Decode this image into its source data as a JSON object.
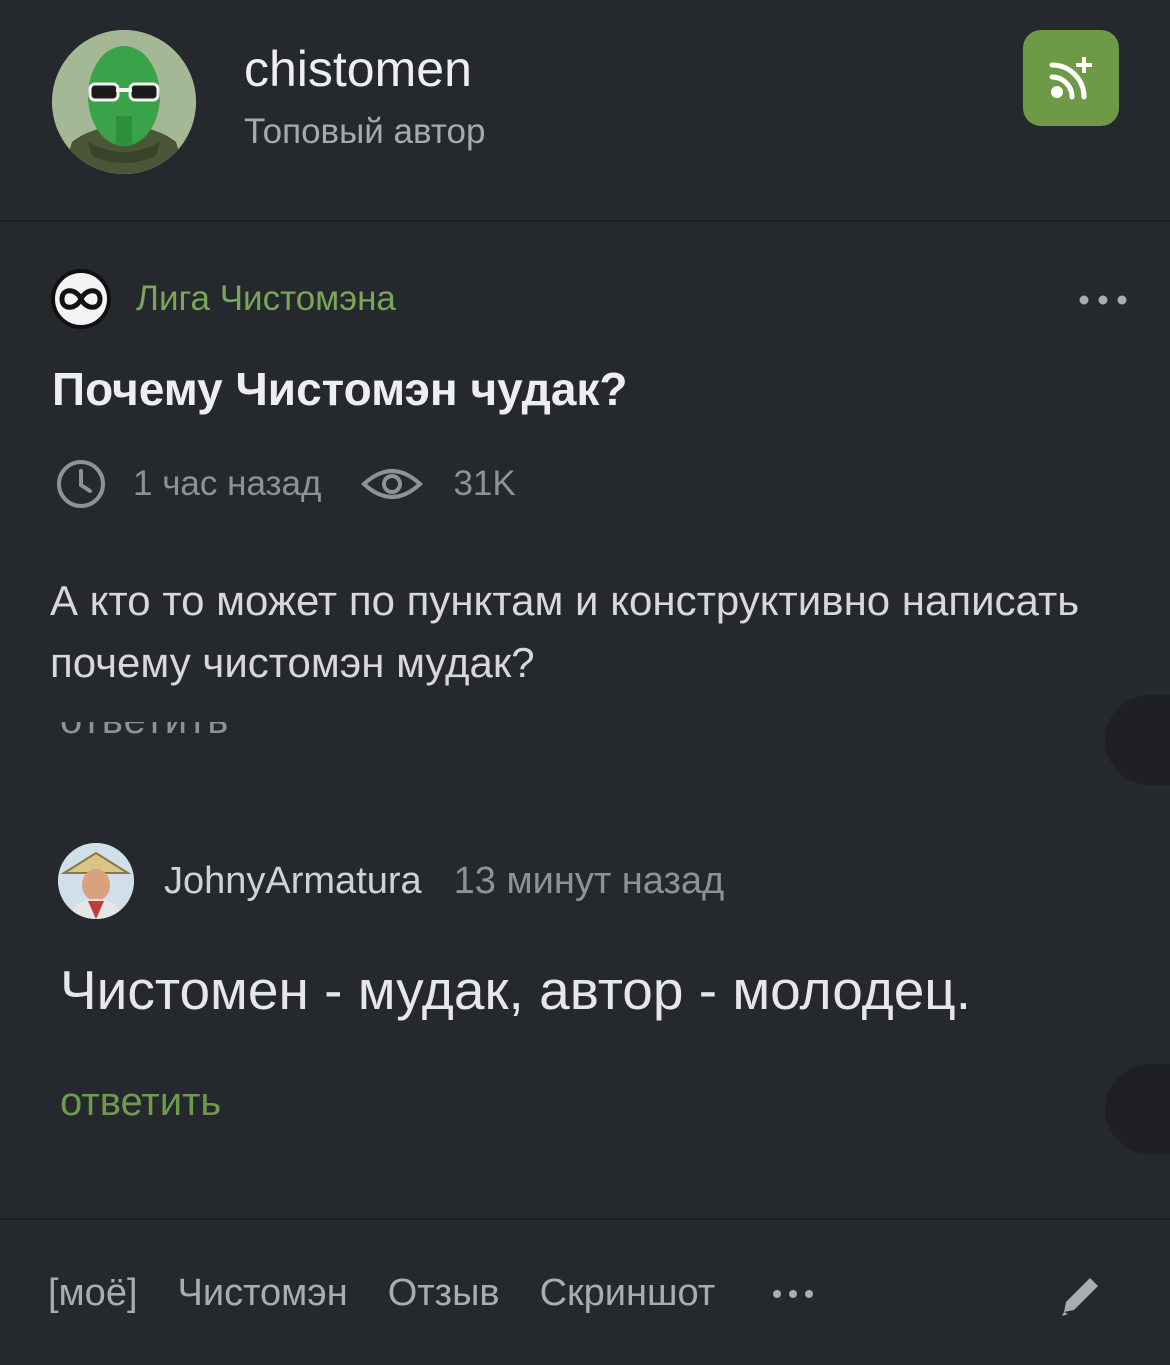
{
  "header": {
    "author_name": "chistomen",
    "author_rank": "Топовый автор",
    "subscribe_icon": "rss-plus-icon"
  },
  "post": {
    "community": "Лига Чистомэна",
    "community_icon": "infinity-icon",
    "title": "Почему Чистомэн чудак?",
    "time": "1 час назад",
    "views": "31K",
    "body": "А кто то может по пунктам и конструктивно написать почему чистомэн мудак?"
  },
  "cut_reply": "ответить",
  "comment": {
    "author": "JohnyArmatura",
    "time": "13 минут назад",
    "text": "Чистомен - мудак, автор - молодец.",
    "reply_label": "ответить"
  },
  "tags": [
    "[моё]",
    "Чистомэн",
    "Отзыв",
    "Скриншот"
  ],
  "colors": {
    "background": "#25282d",
    "accent_green": "#6e9a48",
    "link_green": "#7aa55a"
  }
}
